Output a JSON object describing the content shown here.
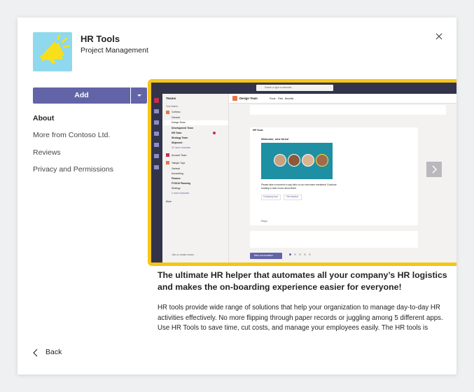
{
  "app": {
    "name": "HR Tools",
    "category": "Project Management",
    "icon": "megaphone-icon"
  },
  "actions": {
    "add_label": "Add",
    "close_icon": "close-icon"
  },
  "nav": {
    "items": [
      {
        "label": "About",
        "active": true
      },
      {
        "label": "More from Contoso Ltd.",
        "active": false
      },
      {
        "label": "Reviews",
        "active": false
      },
      {
        "label": "Privacy and Permissions",
        "active": false
      }
    ],
    "back_label": "Back"
  },
  "carousel": {
    "slide_count": 5,
    "current": 1,
    "screenshot": {
      "search_placeholder": "Search or type a command",
      "panel_title": "Teams",
      "your_teams": "Your teams",
      "channel_header": "Design Team",
      "channel_tabs": [
        "Posts",
        "Files",
        "Benefits"
      ],
      "teams": [
        {
          "name": "Contoso",
          "channels": [
            "General",
            "Design Team"
          ]
        },
        {
          "name": "Development Team",
          "channels": []
        },
        {
          "name": "HR Team",
          "channels": []
        },
        {
          "name": "Strategy Team",
          "channels": []
        },
        {
          "name": "Shipment",
          "channels": [
            "22 more channels"
          ]
        },
        {
          "name": "Account Team",
          "channels": []
        },
        {
          "name": "Tailspin Toys",
          "channels": [
            "General",
            "Accounting",
            "Finance",
            "FY2019 Planning",
            "Strategy",
            "4 more channels"
          ]
        }
      ],
      "more_label": "More",
      "join_label": "Join or create a team",
      "bot_name": "HR Tools",
      "card_title": "Welcome, new hires!",
      "card_text": "Please take a moment to say hello to our new team members! Continue reading to learn more about them.",
      "card_buttons": [
        "Company tour",
        "Get started"
      ],
      "reply_label": "Reply",
      "new_conversation": "New conversation"
    }
  },
  "content": {
    "headline": "The ultimate HR helper that automates all your company’s HR logistics and makes the on-boarding experience easier for everyone!",
    "description": "HR tools provide wide range of solutions that help your organization to manage day-to-day HR activities effectively. No more flipping through paper records or juggling among 5 different apps. Use HR Tools to save time, cut costs, and manage your employees easily. The HR tools is"
  },
  "colors": {
    "accent": "#6264a7",
    "highlight": "#f5c518",
    "app_icon_bg": "#8fd8ee",
    "app_icon_fg": "#f7e01b"
  }
}
